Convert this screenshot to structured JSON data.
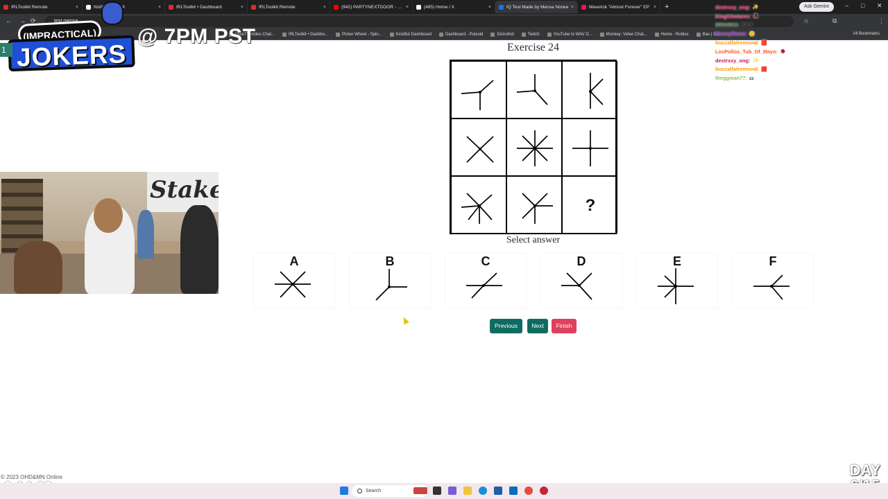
{
  "browser": {
    "tabs": [
      {
        "title": "IRLToolkit Remote",
        "color": "#d93025"
      },
      {
        "title": "Notifications / X",
        "color": "#ffffff"
      },
      {
        "title": "IRLToolkit • Dashboard",
        "color": "#d93025"
      },
      {
        "title": "IRLToolkit Remote",
        "color": "#d93025"
      },
      {
        "title": "(942) PARTYNEXTDOOR - Only",
        "color": "#ff0000"
      },
      {
        "title": "(485) Home / X",
        "color": "#ffffff"
      },
      {
        "title": "IQ Test Made by Mensa Norwa",
        "color": "#1a73e8"
      },
      {
        "title": "Maverick \"Almost Forever\" EP",
        "color": "#e8175d"
      }
    ],
    "new_tab": "+",
    "gemini_label": "Ask Gemini",
    "address": "test.mensa",
    "bookmarks": [
      "OmeTV Video Chat...",
      "IRLToolkit • Dashbo...",
      "Picker Wheel - Spin...",
      "KickBot Dashboard",
      "Dashboard - Pulsoid",
      "DistroKid",
      "Twitch",
      "YouTube to WAV D...",
      "Monkey: Video Chat...",
      "Home - Roblox",
      "Bau | C..."
    ],
    "all_bookmarks": "All Bookmarks"
  },
  "overlay": {
    "logo_top": "(IMPRACTICAL)",
    "logo_main": "JOKERS",
    "schedule": "@ 7PM PST",
    "corner_tag": "1",
    "timer": "9:14:33",
    "day_label": "DAY",
    "day_count": "6/15",
    "copyright": "© 2023 OHD&MN Online",
    "webcam_sign": "Stake"
  },
  "chat": [
    {
      "user": "destrxxy_ong:",
      "color": "#c2185b",
      "emote": "✨"
    },
    {
      "user": "KingXAntares:",
      "color": "#e91e63",
      "emote": "🎩"
    },
    {
      "user": "20010911:",
      "color": "#2e7d32",
      "emote": "x x x"
    },
    {
      "user": "MannyRamz:",
      "color": "#7b1fa2",
      "emote": "🙂"
    },
    {
      "user": "buccalfatremoval:",
      "color": "#ff9800",
      "emote": "🟥"
    },
    {
      "user": "LosPollos_Tub_Of_Mayo:",
      "color": "#ff5722",
      "emote": "🐞"
    },
    {
      "user": "destrxxy_ong:",
      "color": "#c2185b",
      "emote": "✨"
    },
    {
      "user": "buccalfatremoval:",
      "color": "#ff9800",
      "emote": "🟥"
    },
    {
      "user": "theggman77:",
      "color": "#8bc34a",
      "emote": "▭"
    }
  ],
  "exercise": {
    "title": "Exercise 24",
    "select_label": "Select answer",
    "question_mark": "?",
    "options": [
      "A",
      "B",
      "C",
      "D",
      "E",
      "F"
    ],
    "buttons": {
      "previous": "Previous",
      "next": "Next",
      "finish": "Finish"
    }
  },
  "taskbar": {
    "search_placeholder": "Search"
  }
}
